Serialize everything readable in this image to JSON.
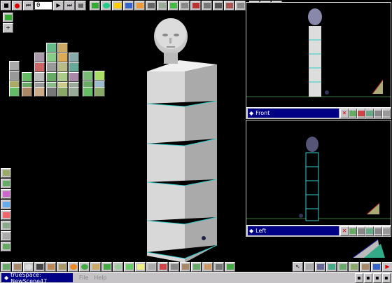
{
  "app": {
    "title": "trueSpace: NewScene47"
  },
  "menu": {
    "file": "File",
    "help": "Help"
  },
  "top_toolbar": {
    "frame_value": "0",
    "buttons": [
      "stop",
      "record",
      "rewind",
      "prev-frame",
      "play",
      "next-frame",
      "end",
      "keyframe-editor",
      "object-tool",
      "paint-tool",
      "scene-tool",
      "render-tool",
      "light-tool",
      "camera-tool",
      "deform-tool",
      "glue-tool",
      "measure-tool",
      "unglue-tool",
      "tools",
      "trash",
      "undo"
    ]
  },
  "viewports": {
    "front": {
      "label": "Front"
    },
    "left": {
      "label": "Left"
    }
  },
  "colors": {
    "background": "#000000",
    "chrome": "#c6c3c6",
    "titlebar": "#000084",
    "accent_edge": "#33cccc",
    "ground_line": "#3c7a3c"
  },
  "status": {
    "task_label": "trueSpace: NewScene47"
  }
}
